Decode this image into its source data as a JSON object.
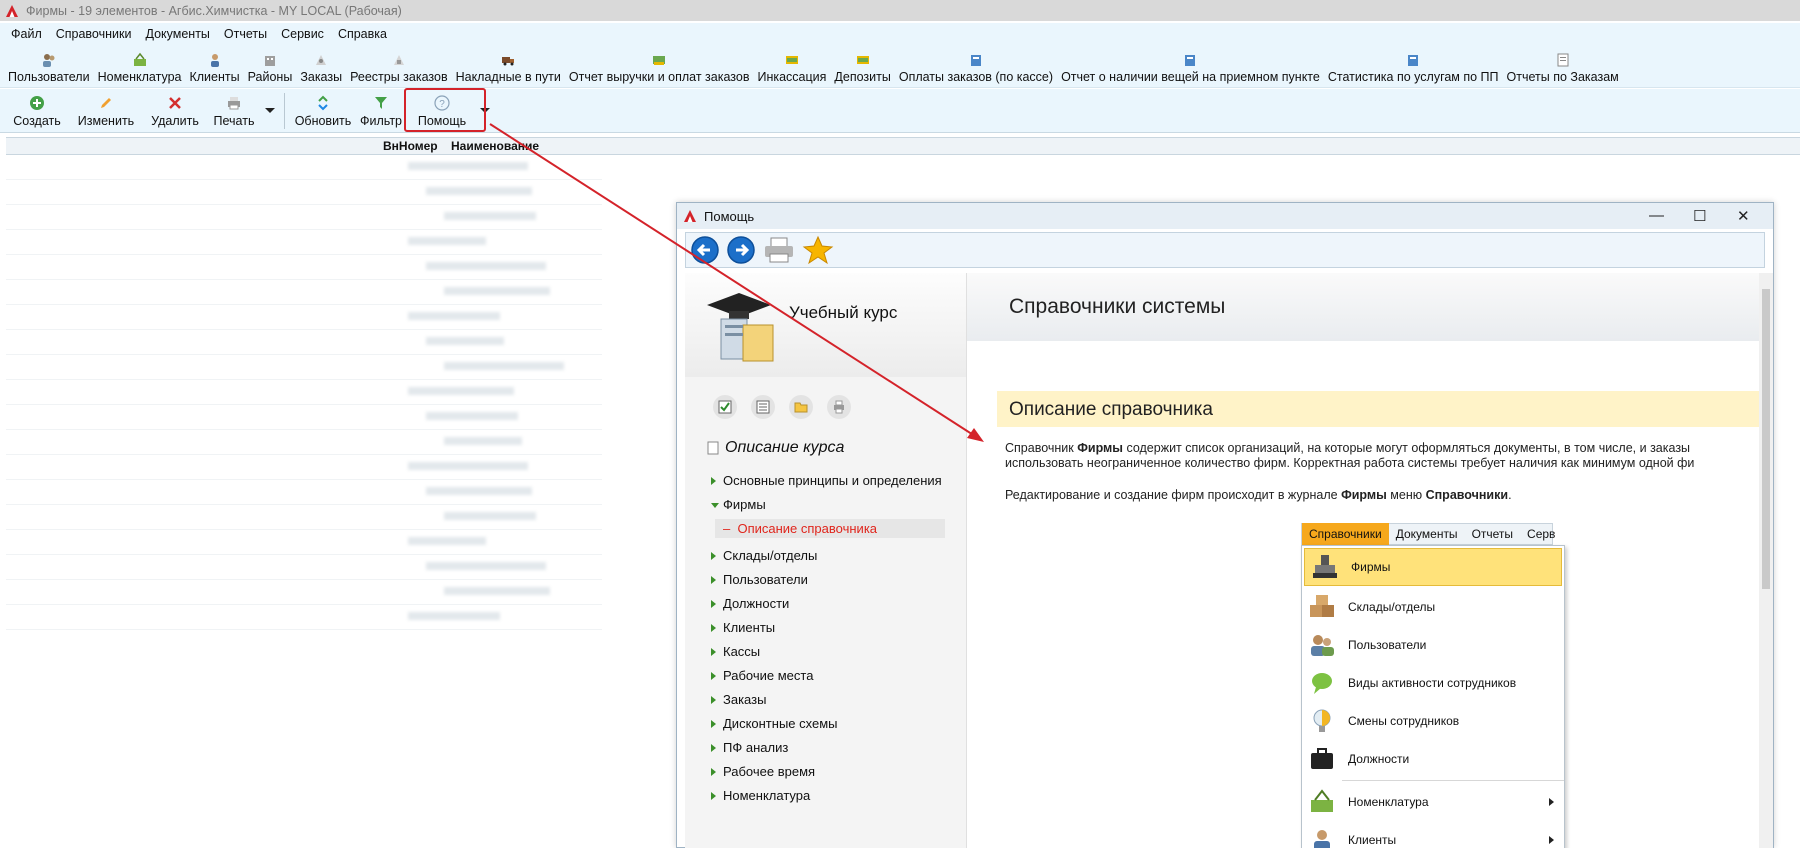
{
  "window": {
    "title": "Фирмы - 19 элементов - Агбис.Химчистка - MY LOCAL (Рабочая)"
  },
  "menu": [
    "Файл",
    "Справочники",
    "Документы",
    "Отчеты",
    "Сервис",
    "Справка"
  ],
  "ref_toolbar": [
    "Пользователи",
    "Номенклатура",
    "Клиенты",
    "Районы",
    "Заказы",
    "Реестры заказов",
    "Накладные в пути",
    "Отчет выручки и оплат заказов",
    "Инкассация",
    "Депозиты",
    "Оплаты заказов (по кассе)",
    "Отчет о наличии вещей на приемном пункте",
    "Статистика по услугам по ПП",
    "Отчеты по Заказам"
  ],
  "actions": {
    "create": "Создать",
    "edit": "Изменить",
    "delete": "Удалить",
    "print": "Печать",
    "refresh": "Обновить",
    "filter": "Фильтр",
    "help": "Помощь"
  },
  "grid": {
    "col_num": "ВнНомер",
    "col_name": "Наименование"
  },
  "help": {
    "title": "Помощь",
    "course_title": "Учебный курс",
    "course_desc": "Описание курса",
    "nav": [
      "Основные принципы и определения",
      "Фирмы",
      "Склады/отделы",
      "Пользователи",
      "Должности",
      "Клиенты",
      "Кассы",
      "Рабочие места",
      "Заказы",
      "Дисконтные схемы",
      "ПФ анализ",
      "Рабочее время",
      "Номенклатура"
    ],
    "nav_sub": "Описание справочника",
    "page_title": "Справочники системы",
    "section_title": "Описание справочника",
    "p1a": "Справочник ",
    "p1b": "Фирмы",
    "p1c": " содержит список организаций, на которые могут оформляться документы, в том числе, и заказы",
    "p2": "использовать неограниченное количество фирм. Корректная работа системы требует наличия как минимум одной фи",
    "p3a": "Редактирование и создание фирм происходит в журнале ",
    "p3b": "Фирмы",
    "p3c": " меню ",
    "p3d": "Справочники",
    "p3e": ".",
    "emb_menu": [
      "Справочники",
      "Документы",
      "Отчеты",
      "Серв"
    ],
    "emb_items": [
      "Фирмы",
      "Склады/отделы",
      "Пользователи",
      "Виды активности сотрудников",
      "Смены сотрудников",
      "Должности",
      "Номенклатура",
      "Клиенты"
    ]
  },
  "colors": {
    "accent_red": "#d4232a",
    "menu_bg": "#eaf6fd",
    "highlight": "#ffe27a",
    "menu_orange": "#f6a81c"
  }
}
